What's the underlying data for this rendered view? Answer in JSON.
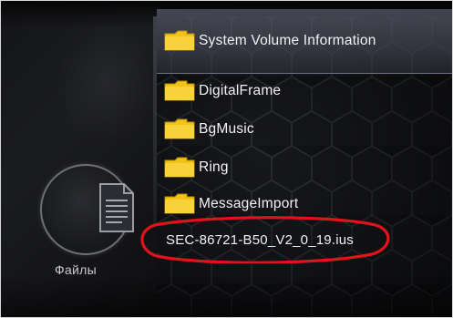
{
  "sidebar": {
    "files_label": "Файлы",
    "icon": "document-icon"
  },
  "file_list": {
    "items": [
      {
        "name": "System Volume Information",
        "type": "folder",
        "selected": true
      },
      {
        "name": "DigitalFrame",
        "type": "folder",
        "selected": false
      },
      {
        "name": "BgMusic",
        "type": "folder",
        "selected": false
      },
      {
        "name": "Ring",
        "type": "folder",
        "selected": false
      },
      {
        "name": "MessageImport",
        "type": "folder",
        "selected": false
      }
    ],
    "firmware_file": "SEC-86721-B50_V2_0_19.ius"
  },
  "colors": {
    "folder": "#f5c418",
    "highlight_circle": "#e0121b",
    "selection": "#6f7488",
    "text": "#f2f2f2"
  }
}
